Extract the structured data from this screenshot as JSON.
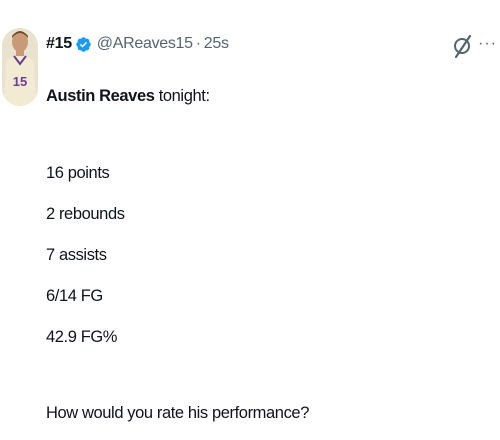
{
  "author": {
    "display_name": "#15",
    "handle": "@AReaves15",
    "separator": "·",
    "time": "25s",
    "verified_icon": "verified-badge-icon",
    "avatar_jersey_number": "15"
  },
  "actions": {
    "grok_icon": "grok-icon",
    "more_label": "···"
  },
  "tweet": {
    "intro_name": "Austin Reaves",
    "intro_rest": " tonight:",
    "stats": [
      "16 points",
      "2 rebounds",
      "7 assists",
      "6/14 FG",
      "42.9 FG%"
    ],
    "question": "How would you rate his performance?"
  },
  "colors": {
    "text": "#0f1419",
    "secondary": "#536471",
    "verified": "#1d9bf0"
  }
}
